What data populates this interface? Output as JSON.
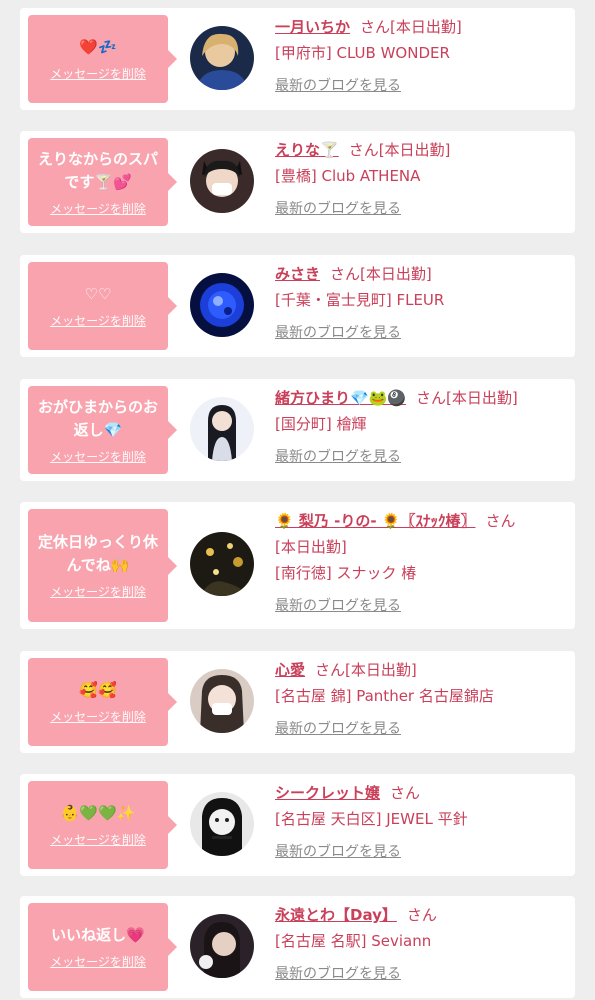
{
  "entries": [
    {
      "message": "❤️💤",
      "delete_label": "メッセージを削除",
      "name": "一月いちか",
      "suffix": "さん[本日出勤]",
      "shop": "[甲府市] CLUB WONDER",
      "blog_label": "最新のブログを見る",
      "avatar_icon": "person-photo-blonde"
    },
    {
      "message": "えりなからのスパです🍸💕",
      "delete_label": "メッセージを削除",
      "name": "えりな🍸",
      "suffix": "さん[本日出勤]",
      "shop": "[豊橋] Club ATHENA",
      "blog_label": "最新のブログを見る",
      "avatar_icon": "person-photo-cat-ears"
    },
    {
      "message": "♡♡",
      "delete_label": "メッセージを削除",
      "name": "みさき",
      "suffix": "さん[本日出勤]",
      "shop": "[千葉・富士見町] FLEUR",
      "blog_label": "最新のブログを見る",
      "avatar_icon": "blue-crystal-photo"
    },
    {
      "message": "おがひまからのお返し💎",
      "delete_label": "メッセージを削除",
      "name": "緒方ひまり💎🐸🎱",
      "suffix": "さん[本日出勤]",
      "shop": "[国分町] 檜輝",
      "blog_label": "最新のブログを見る",
      "avatar_icon": "person-photo-long-hair"
    },
    {
      "message": "定休日ゆっくり休んでね🙌",
      "delete_label": "メッセージを削除",
      "name": "🌻 梨乃 -りの- 🌻〖ｽﾅｯｸ椿〗",
      "suffix": "さん",
      "status": "[本日出勤]",
      "shop": "[南行徳] スナック 椿",
      "blog_label": "最新のブログを見る",
      "avatar_icon": "night-lights-photo"
    },
    {
      "message": "🥰🥰",
      "delete_label": "メッセージを削除",
      "name": "心愛",
      "suffix": "さん[本日出勤]",
      "shop": "[名古屋 錦] Panther 名古屋錦店",
      "blog_label": "最新のブログを見る",
      "avatar_icon": "person-photo-mask"
    },
    {
      "message": "👶💚💚✨",
      "delete_label": "メッセージを削除",
      "name": "シークレット嬢",
      "suffix": "さん",
      "shop": "[名古屋 天白区] JEWEL 平針",
      "blog_label": "最新のブログを見る",
      "avatar_icon": "person-photo-monochrome"
    },
    {
      "message": "いいね返し💗",
      "delete_label": "メッセージを削除",
      "name": "永遠とわ【Day】",
      "suffix": "さん",
      "shop": "[名古屋 名駅] Seviann",
      "blog_label": "最新のブログを見る",
      "avatar_icon": "person-photo-dark"
    }
  ]
}
